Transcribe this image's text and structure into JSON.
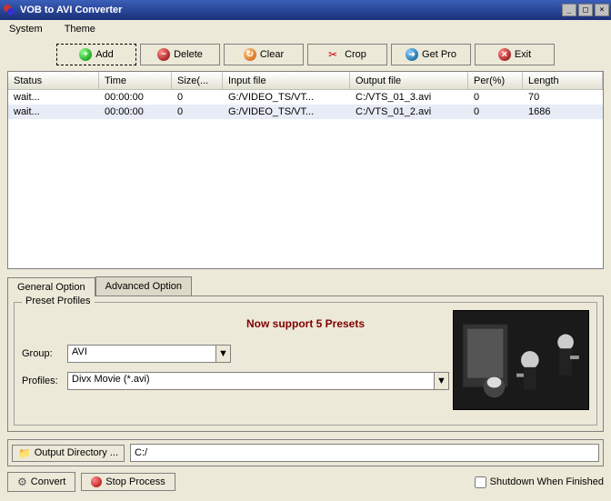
{
  "window": {
    "title": "VOB to AVI Converter"
  },
  "menu": {
    "system": "System",
    "theme": "Theme"
  },
  "toolbar": {
    "add": "Add",
    "delete": "Delete",
    "clear": "Clear",
    "crop": "Crop",
    "getpro": "Get Pro",
    "exit": "Exit"
  },
  "table": {
    "headers": {
      "status": "Status",
      "time": "Time",
      "size": "Size(...",
      "input": "Input file",
      "output": "Output file",
      "per": "Per(%)",
      "length": "Length"
    },
    "rows": [
      {
        "status": "wait...",
        "time": "00:00:00",
        "size": "0",
        "input": "G:/VIDEO_TS/VT...",
        "output": "C:/VTS_01_3.avi",
        "per": "0",
        "length": "70"
      },
      {
        "status": "wait...",
        "time": "00:00:00",
        "size": "0",
        "input": "G:/VIDEO_TS/VT...",
        "output": "C:/VTS_01_2.avi",
        "per": "0",
        "length": "1686"
      }
    ]
  },
  "tabs": {
    "general": "General Option",
    "advanced": "Advanced Option"
  },
  "preset": {
    "legend": "Preset Profiles",
    "message": "Now support 5 Presets",
    "group_label": "Group:",
    "group_value": "AVI",
    "profiles_label": "Profiles:",
    "profiles_value": "Divx Movie (*.avi)"
  },
  "output": {
    "button": "Output Directory ...",
    "path": "C:/"
  },
  "actions": {
    "convert": "Convert",
    "stop": "Stop Process",
    "shutdown": "Shutdown When Finished"
  }
}
